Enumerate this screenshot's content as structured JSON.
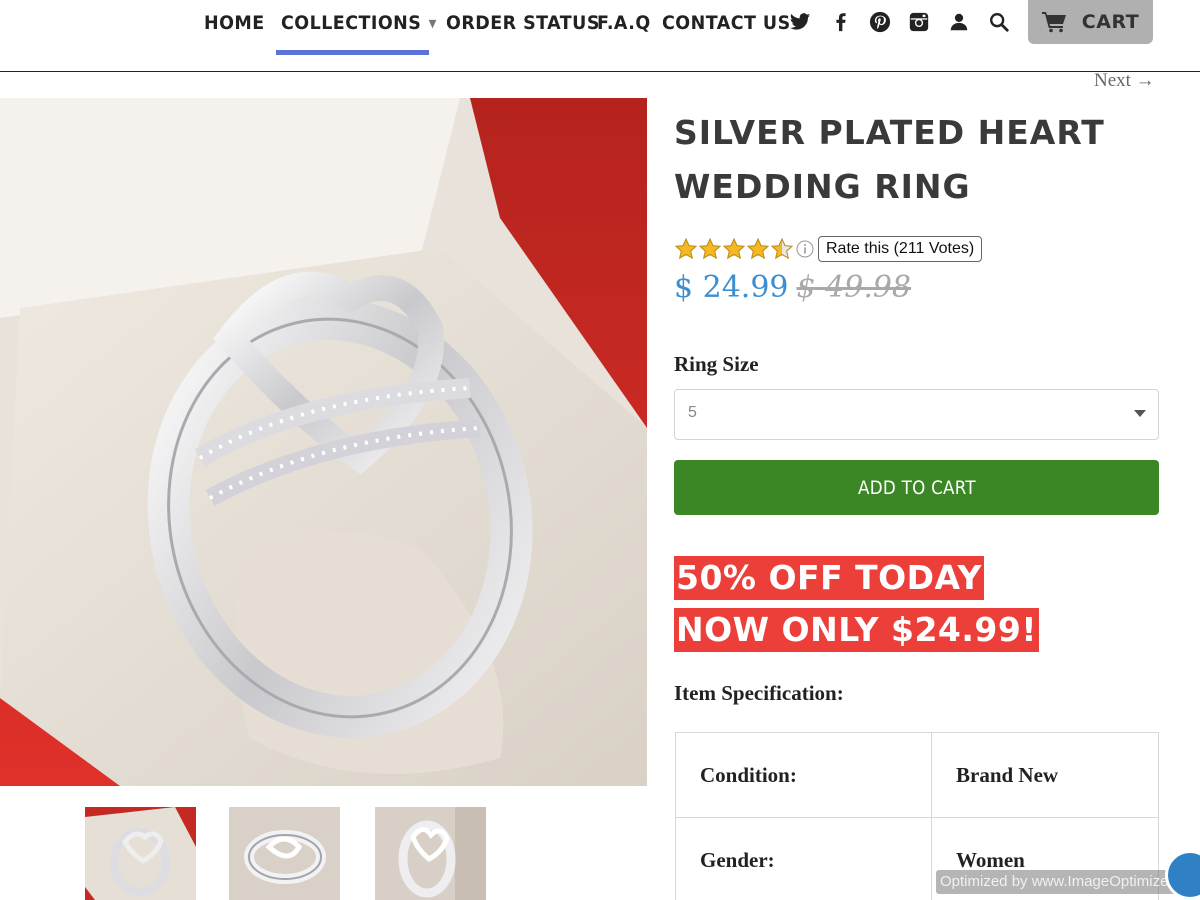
{
  "nav": {
    "items": [
      {
        "label": "HOME"
      },
      {
        "label": "COLLECTIONS"
      },
      {
        "label": "ORDER STATUS"
      },
      {
        "label": "F.A.Q"
      },
      {
        "label": "CONTACT US"
      }
    ],
    "active": "COLLECTIONS",
    "accent_color": "#5b72d6",
    "social_icons": [
      "twitter-icon",
      "facebook-icon",
      "pinterest-icon",
      "instagram-icon",
      "account-icon",
      "search-icon"
    ],
    "cart_label": "CART"
  },
  "pager": {
    "next_label": "Next →"
  },
  "product": {
    "title": "SILVER PLATED HEART WEDDING RING",
    "rating": {
      "stars": 4.5,
      "max": 5,
      "rate_label": "Rate this (211 Votes)"
    },
    "price": "$ 24.99",
    "compare_price": "$ 49.98",
    "ring_size_label": "Ring Size",
    "ring_size_value": "5",
    "add_to_cart_label": "ADD TO CART",
    "promo_line_1": "50% OFF TODAY",
    "promo_line_2": "NOW ONLY $24.99!",
    "spec_heading": "Item Specification:",
    "specs": [
      {
        "key": "Condition:",
        "value": "Brand New"
      },
      {
        "key": "Gender:",
        "value": "Women"
      }
    ]
  },
  "colors": {
    "price": "#3d8ed0",
    "add_to_cart": "#3b8625",
    "promo": "#ec3f3a",
    "cart_button": "#b0b0b0"
  },
  "watermark": "Optimized by www.ImageOptimizer.net"
}
